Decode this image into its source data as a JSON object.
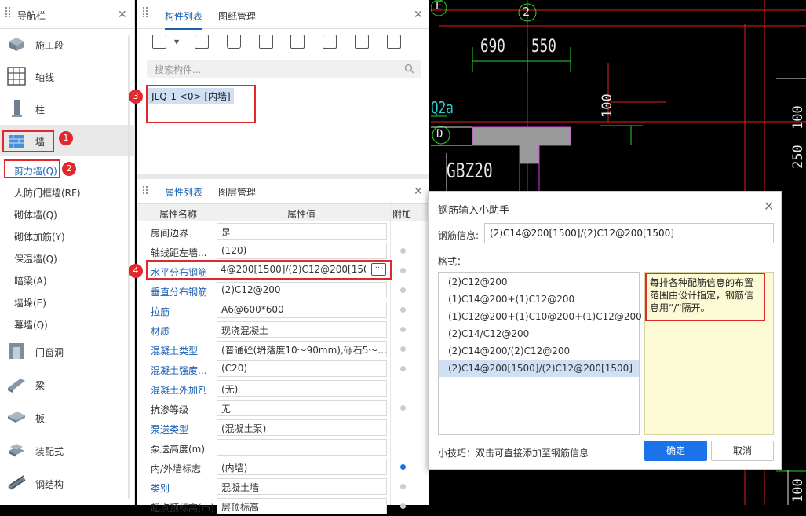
{
  "nav": {
    "title": "导航栏",
    "items": [
      {
        "label": "施工段",
        "icon": "construction-segment-icon"
      },
      {
        "label": "轴线",
        "icon": "axis-grid-icon"
      },
      {
        "label": "柱",
        "icon": "column-icon"
      },
      {
        "label": "墙",
        "icon": "wall-icon"
      },
      {
        "label": "门窗洞",
        "icon": "door-window-icon"
      },
      {
        "label": "梁",
        "icon": "beam-icon"
      },
      {
        "label": "板",
        "icon": "slab-icon"
      },
      {
        "label": "装配式",
        "icon": "prefab-icon"
      },
      {
        "label": "钢结构",
        "icon": "steel-structure-icon"
      }
    ],
    "wall_sub": [
      "剪力墙(Q)",
      "人防门框墙(RF)",
      "砌体墙(Q)",
      "砌体加筋(Y)",
      "保温墙(Q)",
      "暗梁(A)",
      "墙垛(E)",
      "幕墙(Q)"
    ]
  },
  "component_panel": {
    "tabs": [
      "构件列表",
      "图纸管理"
    ],
    "search_placeholder": "搜索构件...",
    "items": [
      "JLQ-1 <0> [内墙]"
    ]
  },
  "property_panel": {
    "tabs": [
      "属性列表",
      "图层管理"
    ],
    "columns": [
      "属性名称",
      "属性值",
      "附加"
    ],
    "rows": [
      {
        "name": "房间边界",
        "value": "是",
        "link": false,
        "dot": "none"
      },
      {
        "name": "轴线距左墙...",
        "value": "(120)",
        "link": false,
        "dot": "off"
      },
      {
        "name": "水平分布钢筋",
        "value": "4@200[1500]/(2)C12@200[1500]",
        "link": true,
        "dot": "off"
      },
      {
        "name": "垂直分布钢筋",
        "value": "(2)C12@200",
        "link": true,
        "dot": "off"
      },
      {
        "name": "拉筋",
        "value": "A6@600*600",
        "link": true,
        "dot": "off"
      },
      {
        "name": "材质",
        "value": "现浇混凝土",
        "link": true,
        "dot": "off"
      },
      {
        "name": "混凝土类型",
        "value": "(普通砼(坍落度10～90mm),砾石5～...",
        "link": true,
        "dot": "off"
      },
      {
        "name": "混凝土强度...",
        "value": "(C20)",
        "link": true,
        "dot": "off"
      },
      {
        "name": "混凝土外加剂",
        "value": "(无)",
        "link": true,
        "dot": "none"
      },
      {
        "name": "抗渗等级",
        "value": "无",
        "link": false,
        "dot": "off"
      },
      {
        "name": "泵送类型",
        "value": "(混凝土泵)",
        "link": true,
        "dot": "none"
      },
      {
        "name": "泵送高度(m)",
        "value": "",
        "link": false,
        "dot": "none"
      },
      {
        "name": "内/外墙标志",
        "value": "(内墙)",
        "link": false,
        "dot": "on"
      },
      {
        "name": "类别",
        "value": "混凝土墙",
        "link": true,
        "dot": "off"
      },
      {
        "name": "起点顶标高(m)",
        "value": "层顶标高",
        "link": false,
        "dot": "off"
      }
    ]
  },
  "cad": {
    "axis_labels": [
      "E",
      "2",
      "D"
    ],
    "dims": [
      "690",
      "550",
      "100",
      "100",
      "250",
      "250",
      "100"
    ],
    "texts": [
      "Q2a",
      "GBZ20"
    ]
  },
  "dialog": {
    "title": "钢筋输入小助手",
    "info_label": "钢筋信息:",
    "info_value": "(2)C14@200[1500]/(2)C12@200[1500]",
    "format_label": "格式：",
    "formats": [
      "(2)C12@200",
      "(1)C14@200+(1)C12@200",
      "(1)C12@200+(1)C10@200+(1)C12@200",
      "(2)C14/C12@200",
      "(2)C14@200/(2)C12@200",
      "(2)C14@200[1500]/(2)C12@200[1500]"
    ],
    "selected_index": 5,
    "hint": "每排各种配筋信息的布置范围由设计指定，钢筋信息用“/”隔开。",
    "tip": "小技巧：双击可直接添加至钢筋信息",
    "ok": "确定",
    "cancel": "取消"
  },
  "badges": [
    "1",
    "2",
    "3",
    "4"
  ],
  "colors": {
    "accent": "#1a5fb4",
    "annotation": "#e0282e",
    "hint_bg": "#fdfbd5"
  }
}
